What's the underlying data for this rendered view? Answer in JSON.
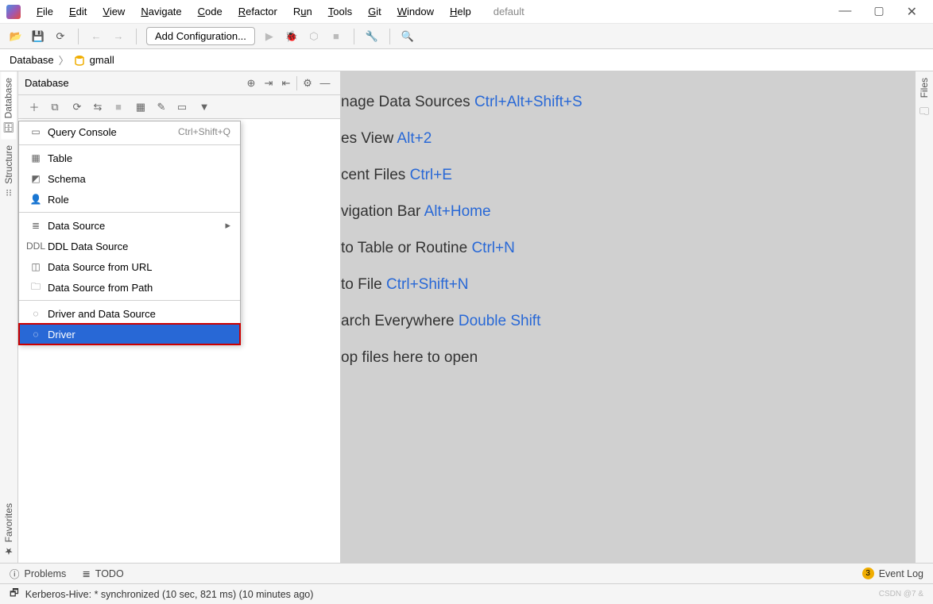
{
  "menubar": {
    "items": [
      "File",
      "Edit",
      "View",
      "Navigate",
      "Code",
      "Refactor",
      "Run",
      "Tools",
      "Git",
      "Window",
      "Help"
    ],
    "project_name": "default"
  },
  "toolbar": {
    "run_config": "Add Configuration..."
  },
  "breadcrumb": {
    "root": "Database",
    "item": "gmall"
  },
  "left_tabs": {
    "database": "Database",
    "structure": "Structure",
    "favorites": "Favorites"
  },
  "right_tabs": {
    "files": "Files"
  },
  "db_panel": {
    "title": "Database"
  },
  "dropdown": {
    "items": [
      {
        "icon": "console",
        "label": "Query Console",
        "shortcut": "Ctrl+Shift+Q"
      },
      {
        "sep": true
      },
      {
        "icon": "table",
        "label": "Table"
      },
      {
        "icon": "schema",
        "label": "Schema"
      },
      {
        "icon": "role",
        "label": "Role"
      },
      {
        "sep": true
      },
      {
        "icon": "datasource",
        "label": "Data Source",
        "arrow": true
      },
      {
        "icon": "ddl",
        "label": "DDL Data Source"
      },
      {
        "icon": "url",
        "label": "Data Source from URL"
      },
      {
        "icon": "path",
        "label": "Data Source from Path"
      },
      {
        "sep": true
      },
      {
        "icon": "driverds",
        "label": "Driver and Data Source"
      },
      {
        "icon": "driver",
        "label": "Driver",
        "highlighted": true
      }
    ]
  },
  "welcome": {
    "rows": [
      {
        "text": "nage Data Sources ",
        "shortcut": "Ctrl+Alt+Shift+S"
      },
      {
        "text": "es View ",
        "shortcut": "Alt+2"
      },
      {
        "text": "cent Files ",
        "shortcut": "Ctrl+E"
      },
      {
        "text": "vigation Bar ",
        "shortcut": "Alt+Home"
      },
      {
        "text": " to Table or Routine ",
        "shortcut": "Ctrl+N"
      },
      {
        "text": " to File ",
        "shortcut": "Ctrl+Shift+N"
      },
      {
        "text": "arch Everywhere ",
        "shortcut": "Double Shift"
      },
      {
        "text": "op files here to open",
        "shortcut": ""
      }
    ]
  },
  "bottom": {
    "problems": "Problems",
    "todo": "TODO",
    "event_log": "Event Log",
    "event_count": "3"
  },
  "status": {
    "text": "Kerberos-Hive: * synchronized (10 sec, 821 ms) (10 minutes ago)",
    "watermark": "CSDN @7 &"
  }
}
